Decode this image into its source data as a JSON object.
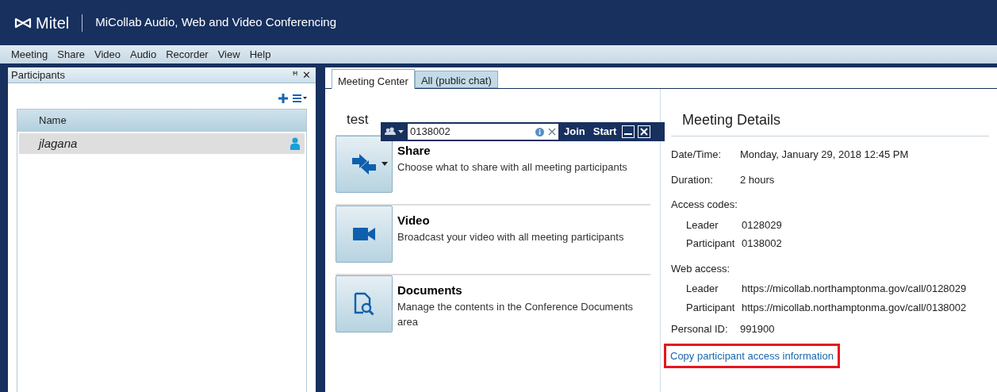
{
  "window": {
    "brand": "Mitel",
    "title": "MiCollab Audio, Web and Video Conferencing"
  },
  "menu": [
    "Meeting",
    "Share",
    "Video",
    "Audio",
    "Recorder",
    "View",
    "Help"
  ],
  "participants_panel": {
    "title": "Participants",
    "pin": "ꟸ",
    "close": "✕",
    "column": "Name",
    "rows": [
      {
        "name": "jlagana",
        "selected": true
      }
    ]
  },
  "tabs": [
    {
      "label": "Meeting Center",
      "selected": true
    },
    {
      "label": "All (public chat)",
      "selected": false
    }
  ],
  "meeting": {
    "name": "test"
  },
  "toolbar": {
    "code": "0138002",
    "join": "Join",
    "start": "Start"
  },
  "actions": [
    {
      "kind": "share",
      "title": "Share",
      "description": "Choose what to share with all meeting participants"
    },
    {
      "kind": "video",
      "title": "Video",
      "description": "Broadcast your video with all meeting participants"
    },
    {
      "kind": "documents",
      "title": "Documents",
      "description": "Manage the contents in the Conference Documents area"
    }
  ],
  "details": {
    "title": "Meeting Details",
    "rows": [
      {
        "label": "Date/Time:",
        "value": "Monday, January 29, 2018 12:45 PM"
      },
      {
        "label": "Duration:",
        "value": "2 hours"
      }
    ],
    "access_codes": {
      "label": "Access codes:",
      "rows": [
        {
          "label": "Leader",
          "value": "0128029"
        },
        {
          "label": "Participant",
          "value": "0138002"
        }
      ]
    },
    "web_access": {
      "label": "Web access:",
      "rows": [
        {
          "label": "Leader",
          "value": "https://micollab.northamptonma.gov/call/0128029"
        },
        {
          "label": "Participant",
          "value": "https://micollab.northamptonma.gov/call/0138002"
        }
      ]
    },
    "personal_id": {
      "label": "Personal ID:",
      "value": "991900"
    },
    "link": {
      "text": "Copy participant access information",
      "highlighted": true
    }
  }
}
